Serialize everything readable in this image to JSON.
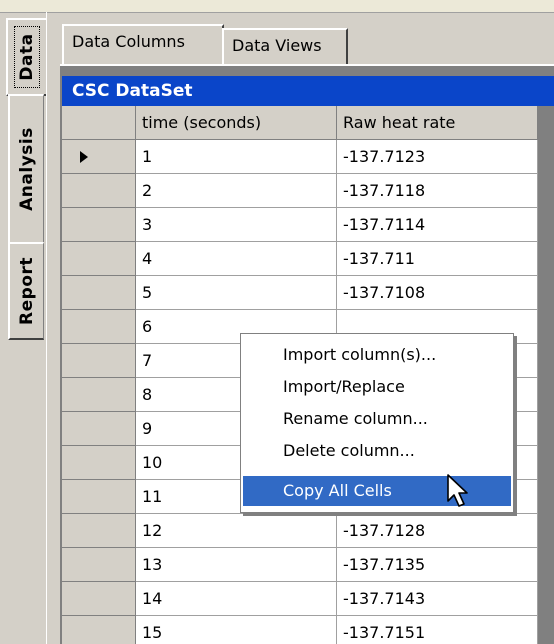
{
  "side_tabs": [
    {
      "label": "Data",
      "active": true
    },
    {
      "label": "Analysis",
      "active": false
    },
    {
      "label": "Report",
      "active": false
    }
  ],
  "top_tabs": [
    {
      "label": "Data Columns",
      "active": true
    },
    {
      "label": "Data Views",
      "active": false
    }
  ],
  "dataset": {
    "caption": "CSC DataSet",
    "columns": [
      "time (seconds)",
      "Raw heat rate"
    ],
    "current_row": 1,
    "rows": [
      [
        "1",
        "-137.7123"
      ],
      [
        "2",
        "-137.7118"
      ],
      [
        "3",
        "-137.7114"
      ],
      [
        "4",
        "-137.711"
      ],
      [
        "5",
        "-137.7108"
      ],
      [
        "6",
        ""
      ],
      [
        "7",
        ""
      ],
      [
        "8",
        ""
      ],
      [
        "9",
        ""
      ],
      [
        "10",
        ""
      ],
      [
        "11",
        ""
      ],
      [
        "12",
        "-137.7128"
      ],
      [
        "13",
        "-137.7135"
      ],
      [
        "14",
        "-137.7143"
      ],
      [
        "15",
        "-137.7151"
      ]
    ]
  },
  "context_menu": {
    "items": [
      {
        "label": "Import column(s)...",
        "selected": false
      },
      {
        "label": "Import/Replace",
        "selected": false
      },
      {
        "label": "Rename column...",
        "selected": false
      },
      {
        "label": "Delete column...",
        "selected": false
      },
      {
        "label": "Copy All Cells",
        "selected": true
      }
    ]
  },
  "colors": {
    "caption_bg": "#0a45c9",
    "menu_highlight": "#316ac5",
    "window_bg": "#d4d0c8"
  }
}
